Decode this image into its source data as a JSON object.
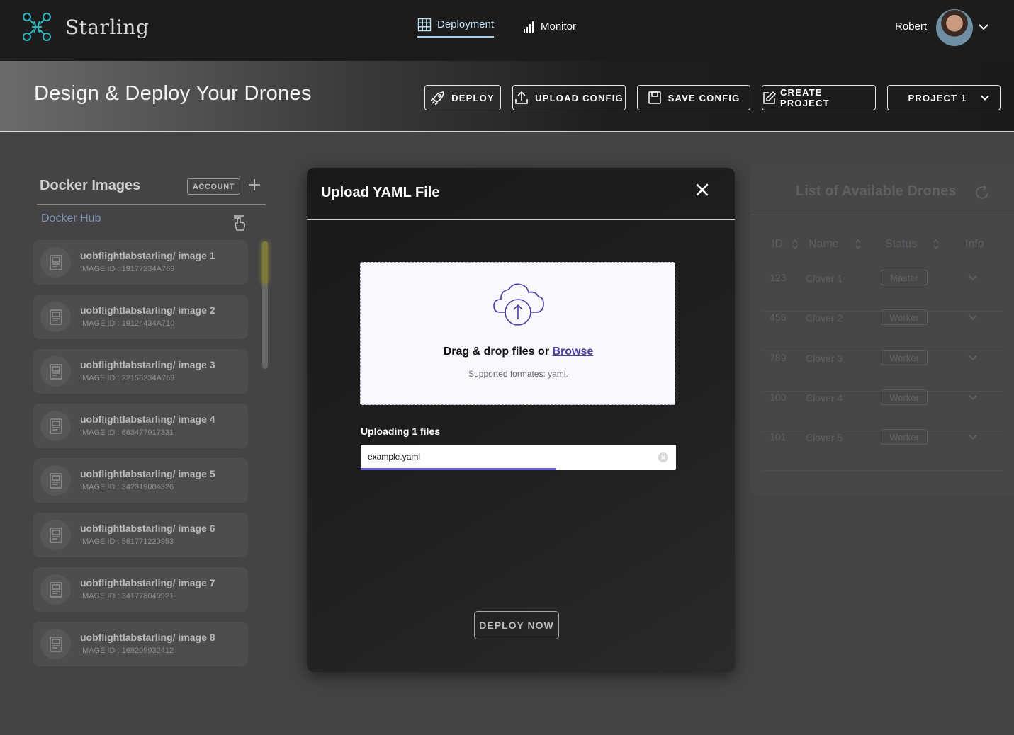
{
  "app": {
    "name": "Starling"
  },
  "nav": {
    "tabs": [
      {
        "label": "Deployment",
        "icon": "grid-icon",
        "active": true
      },
      {
        "label": "Monitor",
        "icon": "signal-bars-icon",
        "active": false
      }
    ],
    "user": {
      "name": "Robert"
    }
  },
  "header": {
    "title": "Design & Deploy Your Drones",
    "buttons": {
      "deploy": "DEPLOY",
      "upload_config": "UPLOAD CONFIG",
      "save_config": "SAVE CONFIG",
      "create_project": "CREATE PROJECT",
      "project_select": "PROJECT 1"
    }
  },
  "docker": {
    "title": "Docker Images",
    "account_label": "ACCOUNT",
    "hub_label": "Docker Hub",
    "images": [
      {
        "name": "uobflightlabstarling/ image 1",
        "id": "IMAGE ID : 19177234A769"
      },
      {
        "name": "uobflightlabstarling/ image 2",
        "id": "IMAGE ID : 19124434A710"
      },
      {
        "name": "uobflightlabstarling/ image 3",
        "id": "IMAGE ID : 22156234A769"
      },
      {
        "name": "uobflightlabstarling/ image 4",
        "id": "IMAGE ID : 663477917331"
      },
      {
        "name": "uobflightlabstarling/ image 5",
        "id": "IMAGE ID : 342319004326"
      },
      {
        "name": "uobflightlabstarling/ image 6",
        "id": "IMAGE ID : 561771220953"
      },
      {
        "name": "uobflightlabstarling/ image 7",
        "id": "IMAGE ID : 341778049921"
      },
      {
        "name": "uobflightlabstarling/ image 8",
        "id": "IMAGE ID : 168209932412"
      }
    ]
  },
  "drones": {
    "title": "List of Available Drones",
    "columns": [
      "ID",
      "Name",
      "Status",
      "Info"
    ],
    "rows": [
      {
        "id": "123",
        "name": "Clover 1",
        "status": "Master"
      },
      {
        "id": "456",
        "name": "Clover 2",
        "status": "Worker"
      },
      {
        "id": "789",
        "name": "Clover 3",
        "status": "Worker"
      },
      {
        "id": "100",
        "name": "Clover 4",
        "status": "Worker"
      },
      {
        "id": "101",
        "name": "Clover 5",
        "status": "Worker"
      }
    ]
  },
  "modal": {
    "title": "Upload YAML File",
    "dropzone_text": "Drag & drop files or",
    "browse_label": "Browse",
    "supported_text": "Supported formates:  yaml.",
    "uploading_label": "Uploading 1 files",
    "file_name": "example.yaml",
    "upload_progress": 0.62,
    "deploy_now_label": "DEPLOY NOW"
  },
  "colors": {
    "nav_bg": "#1c1c1c",
    "accent_purple": "#4b3fa3",
    "progress_fill": "#6b5be0",
    "active_tab_underline": "#9fd3f0",
    "logo_teal": "#2fb6bd"
  }
}
